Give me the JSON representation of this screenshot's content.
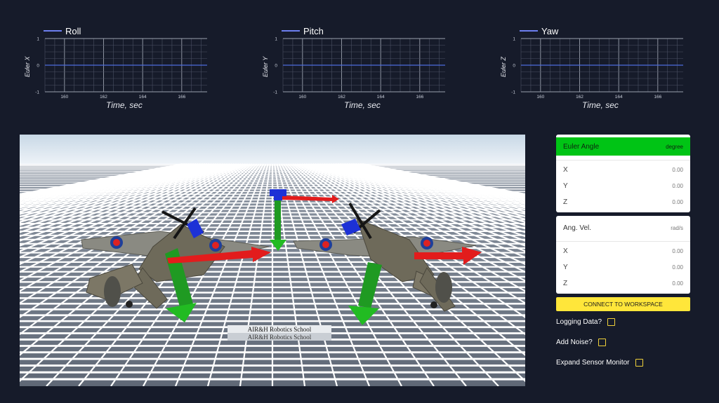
{
  "charts": [
    {
      "legend": "Roll",
      "ylabel": "Euler X",
      "xlabel": "Time, sec",
      "yticks": [
        "1",
        "0",
        "-1"
      ],
      "xticks": [
        "160",
        "162",
        "164",
        "166"
      ],
      "value": 0
    },
    {
      "legend": "Pitch",
      "ylabel": "Euler Y",
      "xlabel": "Time, sec",
      "yticks": [
        "1",
        "0",
        "-1"
      ],
      "xticks": [
        "160",
        "162",
        "164",
        "166"
      ],
      "value": 0
    },
    {
      "legend": "Yaw",
      "ylabel": "Euler Z",
      "xlabel": "Time, sec",
      "yticks": [
        "1",
        "0",
        "-1"
      ],
      "xticks": [
        "160",
        "162",
        "164",
        "166"
      ],
      "value": 0
    }
  ],
  "chart_data": [
    {
      "type": "line",
      "series": [
        {
          "name": "Roll",
          "x": [
            159,
            167.3
          ],
          "y": [
            0,
            0
          ]
        }
      ],
      "xlabel": "Time, sec",
      "ylabel": "Euler X",
      "ylim": [
        -1,
        1
      ],
      "xticks": [
        160,
        162,
        164,
        166
      ],
      "grid": true,
      "legend": "top-left",
      "color": "#4d6bdc"
    },
    {
      "type": "line",
      "series": [
        {
          "name": "Pitch",
          "x": [
            159,
            167.3
          ],
          "y": [
            0,
            0
          ]
        }
      ],
      "xlabel": "Time, sec",
      "ylabel": "Euler Y",
      "ylim": [
        -1,
        1
      ],
      "xticks": [
        160,
        162,
        164,
        166
      ],
      "grid": true,
      "legend": "top-left",
      "color": "#4d6bdc"
    },
    {
      "type": "line",
      "series": [
        {
          "name": "Yaw",
          "x": [
            159,
            167.3
          ],
          "y": [
            0,
            0
          ]
        }
      ],
      "xlabel": "Time, sec",
      "ylabel": "Euler Z",
      "ylim": [
        -1,
        1
      ],
      "xticks": [
        160,
        162,
        164,
        166
      ],
      "grid": true,
      "legend": "top-left",
      "color": "#4d6bdc"
    }
  ],
  "scene": {
    "sign_text": "AIR&H Robotics School"
  },
  "euler_card": {
    "title": "Euler Angle",
    "unit": "degree",
    "rows": [
      {
        "label": "X",
        "value": "0.00"
      },
      {
        "label": "Y",
        "value": "0.00"
      },
      {
        "label": "Z",
        "value": "0.00"
      }
    ]
  },
  "angvel_card": {
    "title": "Ang. Vel.",
    "unit": "rad/s",
    "rows": [
      {
        "label": "X",
        "value": "0.00"
      },
      {
        "label": "Y",
        "value": "0.00"
      },
      {
        "label": "Z",
        "value": "0.00"
      }
    ]
  },
  "connect_button": "CONNECT TO WORKSPACE",
  "options": [
    {
      "label": "Logging Data?"
    },
    {
      "label": "Add Noise?"
    },
    {
      "label": "Expand Sensor Monitor"
    }
  ],
  "colors": {
    "background": "#161b2a",
    "accent_green": "#00c415",
    "button_yellow": "#ffe63a",
    "line_blue": "#4d6bdc"
  }
}
